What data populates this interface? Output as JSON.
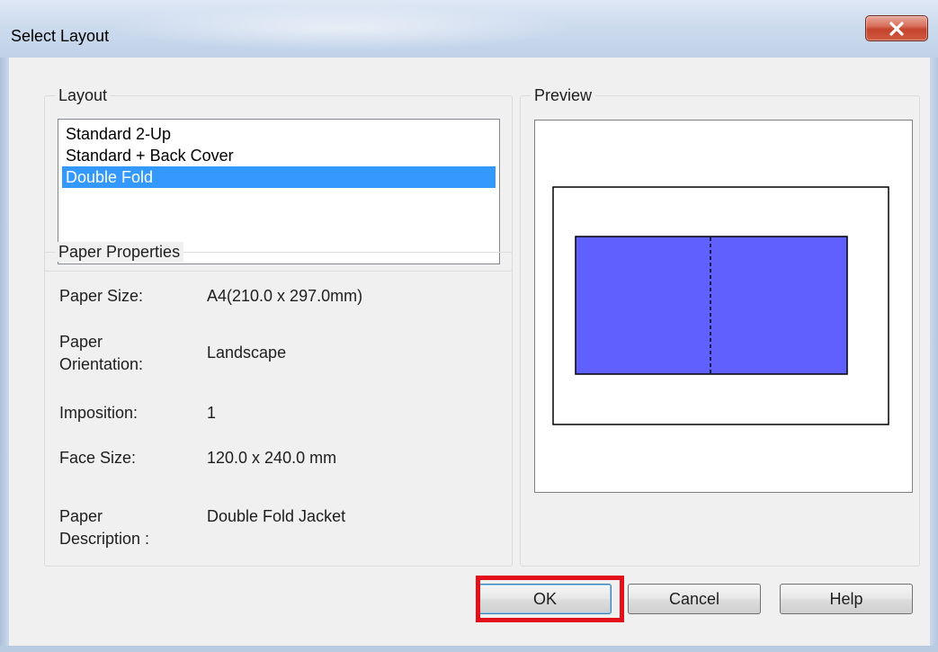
{
  "window": {
    "title": "Select Layout"
  },
  "icons": {
    "close": "close-icon"
  },
  "colors": {
    "selection": "#3399ff",
    "preview_face": "#6060ff",
    "highlight_frame": "#e3101a"
  },
  "layout_group": {
    "label": "Layout",
    "items": [
      {
        "label": "Standard 2-Up",
        "selected": false
      },
      {
        "label": "Standard + Back Cover",
        "selected": false
      },
      {
        "label": "Double Fold",
        "selected": true
      }
    ]
  },
  "paper_properties": {
    "label": "Paper Properties",
    "rows": [
      {
        "label": "Paper Size:",
        "value": "A4(210.0 x 297.0mm)"
      },
      {
        "label_line1": "Paper",
        "label_line2": "Orientation:",
        "value": "Landscape"
      },
      {
        "label": "Imposition:",
        "value": "1"
      },
      {
        "label": "Face Size:",
        "value": "120.0 x 240.0 mm"
      },
      {
        "label_line1": "Paper",
        "label_line2": "Description :",
        "value": "Double Fold Jacket"
      }
    ]
  },
  "preview": {
    "label": "Preview"
  },
  "buttons": {
    "ok": "OK",
    "cancel": "Cancel",
    "help": "Help"
  }
}
